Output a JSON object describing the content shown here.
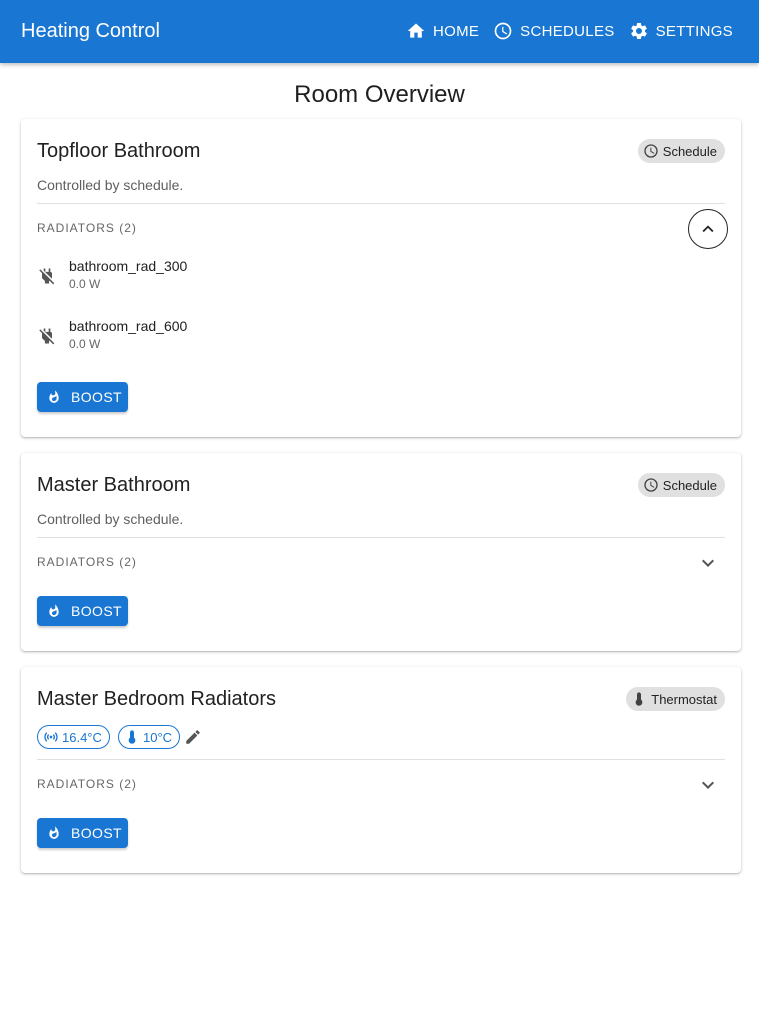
{
  "app": {
    "title": "Heating Control"
  },
  "nav": [
    {
      "label": "HOME",
      "icon": "home-icon"
    },
    {
      "label": "SCHEDULES",
      "icon": "clock-icon"
    },
    {
      "label": "SETTINGS",
      "icon": "gear-icon"
    }
  ],
  "page": {
    "title": "Room Overview"
  },
  "colors": {
    "primary": "#1976d2",
    "chip_bg": "#e0e0e0"
  },
  "rooms": [
    {
      "name": "Topfloor Bathroom",
      "mode": "Schedule",
      "mode_icon": "clock-icon",
      "status": "Controlled by schedule.",
      "radiators_header": "RADIATORS (2)",
      "expanded": true,
      "radiators": [
        {
          "name": "bathroom_rad_300",
          "power": "0.0 W",
          "icon": "power-off-icon"
        },
        {
          "name": "bathroom_rad_600",
          "power": "0.0 W",
          "icon": "power-off-icon"
        }
      ],
      "boost_label": "BOOST"
    },
    {
      "name": "Master Bathroom",
      "mode": "Schedule",
      "mode_icon": "clock-icon",
      "status": "Controlled by schedule.",
      "radiators_header": "RADIATORS (2)",
      "expanded": false,
      "boost_label": "BOOST"
    },
    {
      "name": "Master Bedroom Radiators",
      "mode": "Thermostat",
      "mode_icon": "thermometer-icon",
      "current_temp": "16.4°C",
      "target_temp": "10°C",
      "radiators_header": "RADIATORS (2)",
      "expanded": false,
      "boost_label": "BOOST"
    }
  ]
}
